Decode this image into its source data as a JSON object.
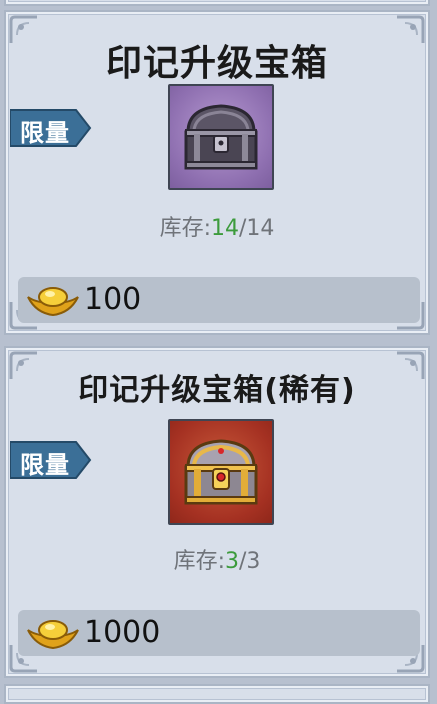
{
  "items": [
    {
      "name": "印记升级宝箱",
      "tag": "限量",
      "stock_label": "库存:",
      "stock_current": "14",
      "stock_separator": "/",
      "stock_max": "14",
      "price": "100",
      "frame_color": "#8e6fb0",
      "icon": "dark-treasure-chest-icon"
    },
    {
      "name": "印记升级宝箱(稀有)",
      "tag": "限量",
      "stock_label": "库存:",
      "stock_current": "3",
      "stock_separator": "/",
      "stock_max": "3",
      "price": "1000",
      "frame_color": "#a53122",
      "icon": "golden-treasure-chest-icon"
    }
  ],
  "currency_icon": "gold-ingot-icon",
  "colors": {
    "card_bg": "#d8dfea",
    "tag_bg": "#3b6f97",
    "stock_current": "#3c9b3c",
    "price_bar": "#b7c0cc"
  }
}
